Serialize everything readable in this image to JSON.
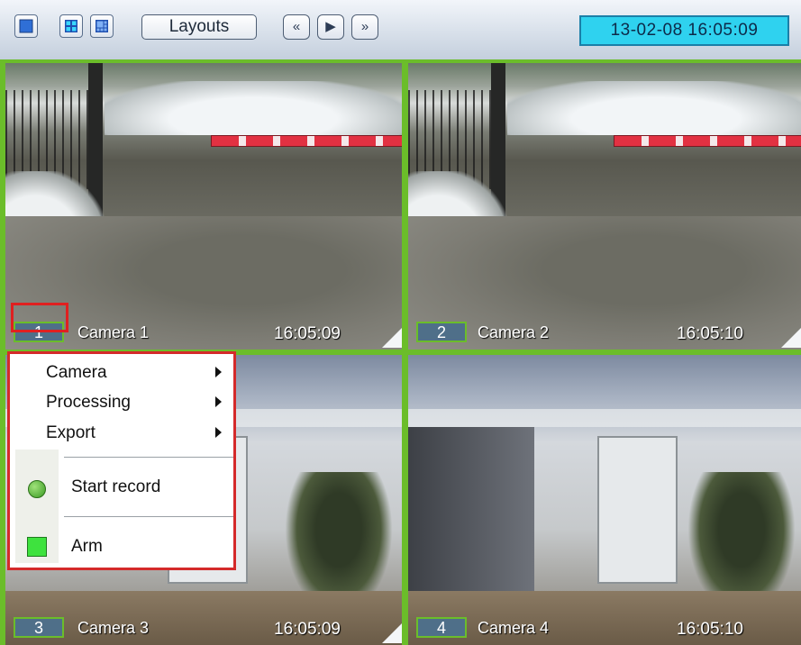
{
  "toolbar": {
    "layouts_label": "Layouts",
    "nav_first": "«",
    "nav_next": "▶",
    "nav_last": "»",
    "datetime": "13-02-08   16:05:09"
  },
  "cameras": [
    {
      "number": "1",
      "name": "Camera 1",
      "time": "16:05:09"
    },
    {
      "number": "2",
      "name": "Camera 2",
      "time": "16:05:10"
    },
    {
      "number": "3",
      "name": "Camera 3",
      "time": "16:05:09"
    },
    {
      "number": "4",
      "name": "Camera 4",
      "time": "16:05:10"
    }
  ],
  "context_menu": {
    "items": [
      {
        "label": "Camera"
      },
      {
        "label": "Processing"
      },
      {
        "label": "Export"
      },
      {
        "label": "Start record"
      },
      {
        "label": "Arm"
      }
    ]
  },
  "colors": {
    "grid_border": "#6bbd2a",
    "datetime_bg": "#2fd2ef",
    "highlight": "#d42a2a"
  }
}
